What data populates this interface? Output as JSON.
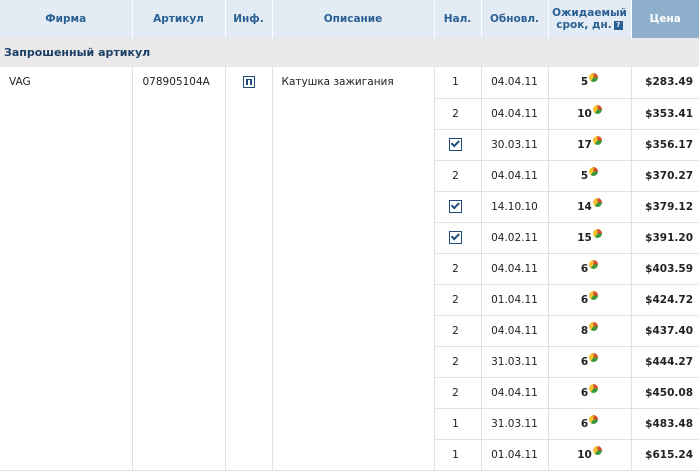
{
  "headers": {
    "firm": "Фирма",
    "article": "Артикул",
    "info": "Инф.",
    "description": "Описание",
    "availability": "Нал.",
    "updated": "Обновл.",
    "expected_line1": "Ожидаемый",
    "expected_line2": "срок, дн.",
    "help_mark": "?",
    "price": "Цена"
  },
  "section_title": "Запрошенный артикул",
  "item": {
    "firm": "VAG",
    "article": "078905104A",
    "description": "Катушка зажигания"
  },
  "rows": [
    {
      "avail": "1",
      "checked": false,
      "date": "04.04.11",
      "days": "5",
      "price": "$283.49"
    },
    {
      "avail": "2",
      "checked": false,
      "date": "04.04.11",
      "days": "10",
      "price": "$353.41"
    },
    {
      "avail": "",
      "checked": true,
      "date": "30.03.11",
      "days": "17",
      "price": "$356.17"
    },
    {
      "avail": "2",
      "checked": false,
      "date": "04.04.11",
      "days": "5",
      "price": "$370.27"
    },
    {
      "avail": "",
      "checked": true,
      "date": "14.10.10",
      "days": "14",
      "price": "$379.12"
    },
    {
      "avail": "",
      "checked": true,
      "date": "04.02.11",
      "days": "15",
      "price": "$391.20"
    },
    {
      "avail": "2",
      "checked": false,
      "date": "04.04.11",
      "days": "6",
      "price": "$403.59"
    },
    {
      "avail": "2",
      "checked": false,
      "date": "01.04.11",
      "days": "6",
      "price": "$424.72"
    },
    {
      "avail": "2",
      "checked": false,
      "date": "04.04.11",
      "days": "8",
      "price": "$437.40"
    },
    {
      "avail": "2",
      "checked": false,
      "date": "31.03.11",
      "days": "6",
      "price": "$444.27"
    },
    {
      "avail": "2",
      "checked": false,
      "date": "04.04.11",
      "days": "6",
      "price": "$450.08"
    },
    {
      "avail": "1",
      "checked": false,
      "date": "31.03.11",
      "days": "6",
      "price": "$483.48"
    },
    {
      "avail": "1",
      "checked": false,
      "date": "01.04.11",
      "days": "10",
      "price": "$615.24"
    }
  ],
  "colors": {
    "header_bg": "#e3ecf4",
    "header_text": "#2a5f93",
    "price_header_bg": "#8fb0cc",
    "section_bg": "#e9e9e9"
  },
  "icons": {
    "info": "info-icon",
    "availability_check": "checkbox-checked-icon",
    "reliability": "pie-chart-icon"
  }
}
